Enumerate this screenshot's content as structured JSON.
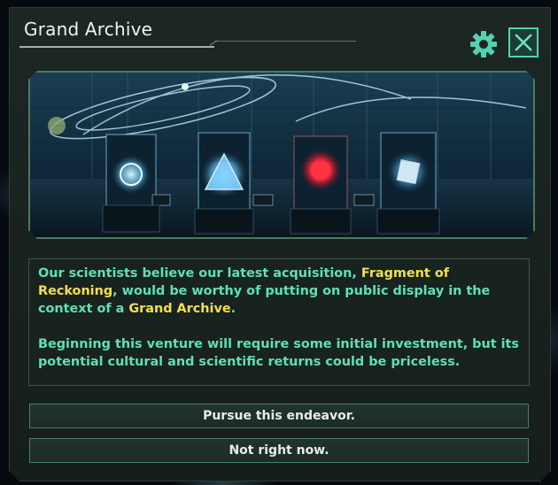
{
  "dialog": {
    "title": "Grand Archive",
    "gear_icon": "gear-icon",
    "close_icon": "close-icon",
    "accent_color": "#55d0b0"
  },
  "banner": {
    "image": "archive-hall-illustration",
    "exhibits": [
      "sphere-exhibit",
      "pyramid-exhibit",
      "red-orb-exhibit",
      "crystal-exhibit"
    ]
  },
  "description": {
    "para1_a": "Our scientists believe our latest acquisition, ",
    "para1_highlight1": "Fragment of Reckoning",
    "para1_b": ", would be worthy of putting on public display in the context of a ",
    "para1_highlight2": "Grand Archive",
    "para1_c": ".",
    "para2": "Beginning this venture will require some initial investment, but its potential cultural and scientific returns could be priceless.",
    "text_color": "#5fe0b6",
    "highlight_color": "#f3e04a"
  },
  "options": [
    {
      "label": "Pursue this endeavor."
    },
    {
      "label": "Not right now."
    }
  ]
}
